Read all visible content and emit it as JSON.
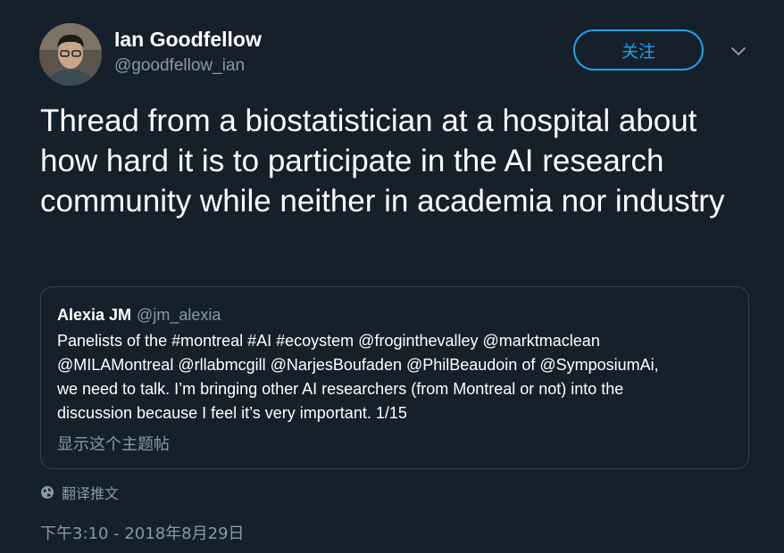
{
  "author": {
    "display_name": "Ian Goodfellow",
    "handle": "@goodfellow_ian"
  },
  "actions": {
    "follow_label": "关注",
    "more_icon": "chevron-down-icon"
  },
  "tweet": {
    "text": "Thread from a biostatistician at a hospital about how hard it is to participate in the AI research community while neither in academia nor industry"
  },
  "quoted_tweet": {
    "display_name": "Alexia JM",
    "handle": "@jm_alexia",
    "lines": [
      "Panelists of the #montreal #AI #ecoystem @froginthevalley @marktmaclean",
      "@MILAMontreal @rllabmcgill @NarjesBoufaden @PhilBeaudoin of @SymposiumAi,",
      "we need to talk. I’m bringing other AI researchers (from Montreal or not) into the",
      "discussion because I feel it’s very important. 1/15"
    ],
    "show_thread_label": "显示这个主题帖"
  },
  "footer": {
    "translate_label": "翻译推文",
    "translate_icon": "globe-icon",
    "timestamp": "下午3:10 - 2018年8月29日"
  },
  "colors": {
    "background": "#15202b",
    "accent": "#1da1f2",
    "secondary_text": "#8899a6",
    "border": "#38444d"
  }
}
